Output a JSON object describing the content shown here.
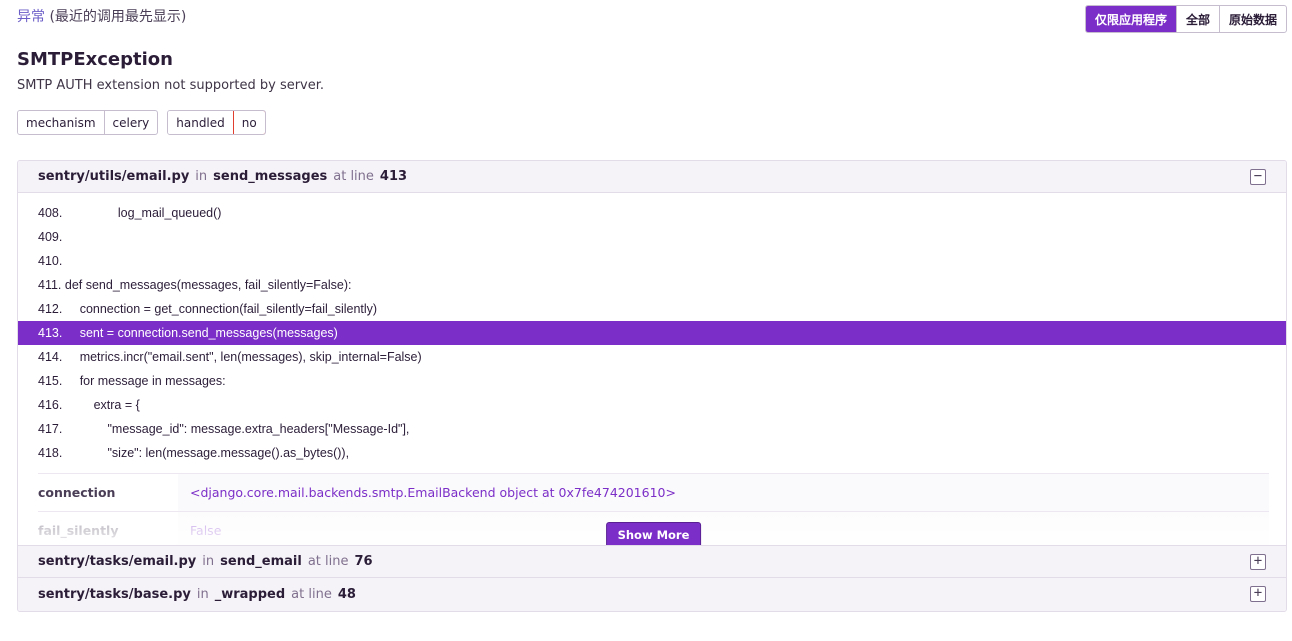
{
  "section": {
    "title": "异常",
    "subtitle": "(最近的调用最先显示)"
  },
  "view_toggle": {
    "app_only": "仅限应用程序",
    "all": "全部",
    "raw": "原始数据"
  },
  "exception": {
    "type": "SMTPException",
    "message": "SMTP AUTH extension not supported by server."
  },
  "tags": [
    {
      "key": "mechanism",
      "value": "celery"
    },
    {
      "key": "handled",
      "value": "no"
    }
  ],
  "frames": [
    {
      "file": "sentry/utils/email.py",
      "in_label": "in",
      "function": "send_messages",
      "at_line_label": "at line",
      "line": "413",
      "toggle": "−",
      "code": [
        {
          "text": "408.                log_mail_queued()",
          "active": false
        },
        {
          "text": "409.",
          "active": false
        },
        {
          "text": "410.",
          "active": false
        },
        {
          "text": "411. def send_messages(messages, fail_silently=False):",
          "active": false
        },
        {
          "text": "412.     connection = get_connection(fail_silently=fail_silently)",
          "active": false
        },
        {
          "text": "413.     sent = connection.send_messages(messages)",
          "active": true
        },
        {
          "text": "414.     metrics.incr(\"email.sent\", len(messages), skip_internal=False)",
          "active": false
        },
        {
          "text": "415.     for message in messages:",
          "active": false
        },
        {
          "text": "416.         extra = {",
          "active": false
        },
        {
          "text": "417.             \"message_id\": message.extra_headers[\"Message-Id\"],",
          "active": false
        },
        {
          "text": "418.             \"size\": len(message.message().as_bytes()),",
          "active": false
        }
      ],
      "vars": [
        {
          "key": "connection",
          "value": "<django.core.mail.backends.smtp.EmailBackend object at 0x7fe474201610>"
        },
        {
          "key": "fail_silently",
          "value": "False"
        }
      ],
      "show_more": "Show More"
    },
    {
      "file": "sentry/tasks/email.py",
      "in_label": "in",
      "function": "send_email",
      "at_line_label": "at line",
      "line": "76",
      "toggle": "+"
    },
    {
      "file": "sentry/tasks/base.py",
      "in_label": "in",
      "function": "_wrapped",
      "at_line_label": "at line",
      "line": "48",
      "toggle": "+"
    }
  ],
  "colors": {
    "accent": "#7c2fc8",
    "error_border": "#e03e2f"
  }
}
